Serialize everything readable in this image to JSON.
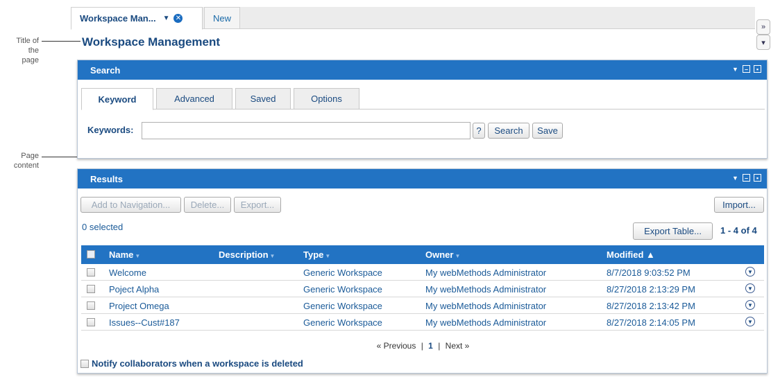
{
  "callouts": {
    "title_note": [
      "Title of",
      "the page"
    ],
    "content_note": [
      "Page",
      "content"
    ]
  },
  "tabs": [
    {
      "label": "Workspace Man...",
      "active": true
    },
    {
      "label": "New",
      "active": false
    }
  ],
  "side_buttons": {
    "expand": "»",
    "menu": "▾"
  },
  "page_title": "Workspace Management",
  "search": {
    "panel_title": "Search",
    "tabs": [
      "Keyword",
      "Advanced",
      "Saved",
      "Options"
    ],
    "keywords_label": "Keywords:",
    "keywords_value": "",
    "help_label": "?",
    "search_label": "Search",
    "save_label": "Save"
  },
  "results": {
    "panel_title": "Results",
    "toolbar": {
      "add_nav": "Add to Navigation...",
      "delete": "Delete...",
      "export": "Export...",
      "import": "Import..."
    },
    "selected_count": "0 selected",
    "export_table": "Export Table...",
    "range": "1 - 4 of 4",
    "columns": [
      "Name",
      "Description",
      "Type",
      "Owner",
      "Modified ▲"
    ],
    "rows": [
      {
        "name": "Welcome",
        "description": "",
        "type": "Generic Workspace",
        "owner": "My webMethods Administrator",
        "modified": "8/7/2018 9:03:52 PM"
      },
      {
        "name": "Poject Alpha",
        "description": "",
        "type": "Generic Workspace",
        "owner": "My webMethods Administrator",
        "modified": "8/27/2018 2:13:29 PM"
      },
      {
        "name": "Project Omega",
        "description": "",
        "type": "Generic Workspace",
        "owner": "My webMethods Administrator",
        "modified": "8/27/2018 2:13:42 PM"
      },
      {
        "name": "Issues--Cust#187",
        "description": "",
        "type": "Generic Workspace",
        "owner": "My webMethods Administrator",
        "modified": "8/27/2018 2:14:05 PM"
      }
    ],
    "pager": {
      "prev": "« Previous",
      "sep": "|",
      "page": "1",
      "next": "Next »"
    },
    "notify_label": "Notify collaborators when a workspace is deleted"
  },
  "colors": {
    "header_blue": "#2273c3",
    "link_blue": "#1a5a98",
    "title_blue": "#1a4a80"
  }
}
